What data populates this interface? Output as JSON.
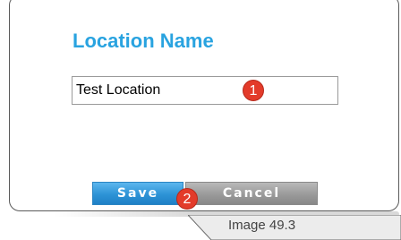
{
  "dialog": {
    "title": "Location Name",
    "location_input_value": "Test Location",
    "save_label": "Save",
    "cancel_label": "Cancel"
  },
  "markers": [
    "1",
    "2"
  ],
  "caption": "Image 49.3",
  "colors": {
    "title": "#29a3e0",
    "save_button": "#2d93d6",
    "cancel_button": "#9a9a9a",
    "marker": "#e33b2a"
  }
}
